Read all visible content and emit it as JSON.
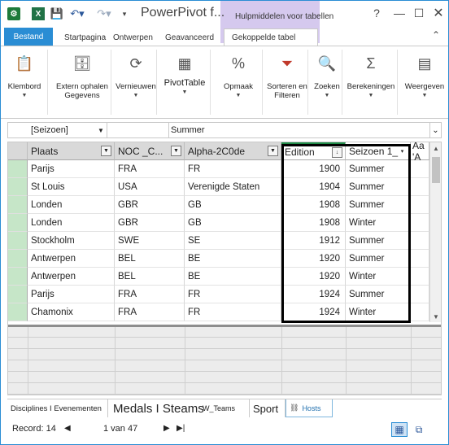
{
  "title_bar": {
    "window_title": "PowerPivot f...",
    "context_tab_title": "Hulpmiddelen voor tabellen",
    "app_icon": "powerpivot-icon",
    "excel_icon": "excel-icon",
    "help": "?",
    "minimize": "—",
    "maximize": "☐",
    "close": "✕"
  },
  "tabs": {
    "file": "Bestand",
    "items": [
      "Startpagina",
      "Ontwerpen",
      "Geavanceerd",
      "Gekoppelde tabel"
    ]
  },
  "ribbon": {
    "buttons": [
      {
        "label": "Klembord",
        "icon": "clipboard-icon",
        "glyph": "📋"
      },
      {
        "label": "Extern ophalen\nGegevens",
        "icon": "external-data-icon",
        "glyph": "🗄"
      },
      {
        "label": "Vernieuwen",
        "icon": "refresh-icon",
        "glyph": "⟳"
      },
      {
        "label": "PivotTable",
        "icon": "pivottable-icon",
        "glyph": "▦"
      },
      {
        "label": "Opmaak",
        "icon": "percent-icon",
        "glyph": "%"
      },
      {
        "label": "Sorteren en\nFilteren",
        "icon": "sort-filter-icon",
        "glyph": "⏷"
      },
      {
        "label": "Zoeken",
        "icon": "binoculars-icon",
        "glyph": "🔍"
      },
      {
        "label": "Berekeningen",
        "icon": "sigma-icon",
        "glyph": "Σ"
      },
      {
        "label": "Weergeven",
        "icon": "view-icon",
        "glyph": "▤"
      }
    ]
  },
  "formula_bar": {
    "name_box": "[Seizoen]",
    "value": "Summer"
  },
  "grid": {
    "columns": [
      "Plaats",
      "NOC _C...",
      "Alpha-2C0de",
      "Edition",
      "Seizoen 1_",
      "Aa 'A"
    ],
    "rows": [
      [
        "Parijs",
        "FRA",
        "FR",
        "1900",
        "Summer"
      ],
      [
        "St Louis",
        "USA",
        "Verenigde Staten",
        "1904",
        "Summer"
      ],
      [
        "Londen",
        "GBR",
        "GB",
        "1908",
        "Summer"
      ],
      [
        "Londen",
        "GBR",
        "GB",
        "1908",
        "Winter"
      ],
      [
        "Stockholm",
        "SWE",
        "SE",
        "1912",
        "Summer"
      ],
      [
        "Antwerpen",
        "BEL",
        "BE",
        "1920",
        "Summer"
      ],
      [
        "Antwerpen",
        "BEL",
        "BE",
        "1920",
        "Winter"
      ],
      [
        "Parijs",
        "FRA",
        "FR",
        "1924",
        "Summer"
      ],
      [
        "Chamonix",
        "FRA",
        "FR",
        "1924",
        "Winter"
      ]
    ]
  },
  "sheet_tabs": {
    "items": [
      "Disciplines I Evenementen",
      "Medals I Steams",
      "W_Teams",
      "Sport",
      "Hosts"
    ],
    "active": "Hosts"
  },
  "status_bar": {
    "record_label": "Record: 14",
    "position": "1 van 47"
  }
}
